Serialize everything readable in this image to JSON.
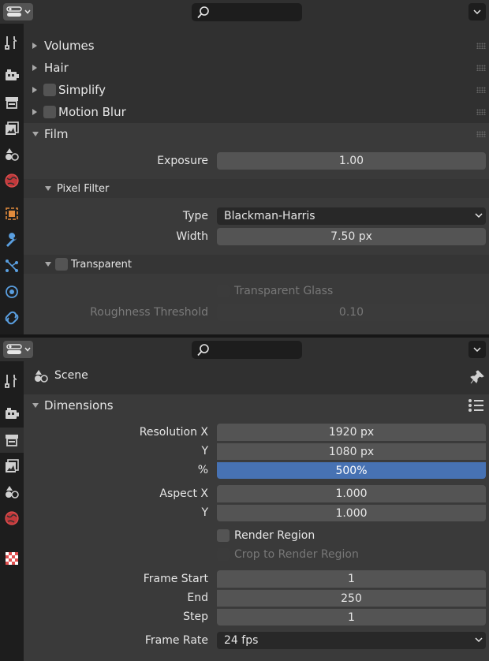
{
  "top_editor": {
    "panels": [
      {
        "label": "Volumes",
        "expanded": false,
        "checkbox": false
      },
      {
        "label": "Hair",
        "expanded": false,
        "checkbox": false
      },
      {
        "label": "Simplify",
        "expanded": false,
        "checkbox": true
      },
      {
        "label": "Motion Blur",
        "expanded": false,
        "checkbox": true
      },
      {
        "label": "Film",
        "expanded": true,
        "checkbox": false
      }
    ],
    "film": {
      "exposure_label": "Exposure",
      "exposure_value": "1.00",
      "pixel_filter": {
        "label": "Pixel Filter",
        "type_label": "Type",
        "type_value": "Blackman-Harris",
        "width_label": "Width",
        "width_value": "7.50 px"
      },
      "transparent": {
        "label": "Transparent",
        "glass_label": "Transparent Glass",
        "roughness_label": "Roughness Threshold",
        "roughness_value": "0.10"
      }
    },
    "tabs": [
      "tool-icon",
      "render-icon",
      "output-icon",
      "view-layer-icon",
      "scene-icon",
      "world-icon",
      "object-icon",
      "modifier-icon",
      "particles-icon",
      "physics-icon",
      "constraints-icon"
    ]
  },
  "bottom_editor": {
    "context": {
      "label": "Scene",
      "icon": "scene-icon",
      "pin": "pin-icon"
    },
    "dimensions": {
      "label": "Dimensions",
      "resolution_x_label": "Resolution X",
      "resolution_x": "1920 px",
      "resolution_y_label": "Y",
      "resolution_y": "1080 px",
      "percent_label": "%",
      "percent": "500%",
      "percent_fraction": 1.0,
      "aspect_x_label": "Aspect X",
      "aspect_x": "1.000",
      "aspect_y_label": "Y",
      "aspect_y": "1.000",
      "render_region_label": "Render Region",
      "crop_label": "Crop to Render Region",
      "frame_start_label": "Frame Start",
      "frame_start": "1",
      "frame_end_label": "End",
      "frame_end": "250",
      "frame_step_label": "Step",
      "frame_step": "1",
      "frame_rate_label": "Frame Rate",
      "frame_rate": "24 fps"
    },
    "tabs": [
      "tool-icon",
      "render-icon",
      "output-icon",
      "view-layer-icon",
      "scene-icon",
      "world-icon",
      "texture-icon"
    ]
  },
  "colors": {
    "accent_blue": "#4772b3",
    "panel_bg": "#303030",
    "field_bg": "#545454",
    "tab_bar_bg": "#1d1d1d"
  }
}
